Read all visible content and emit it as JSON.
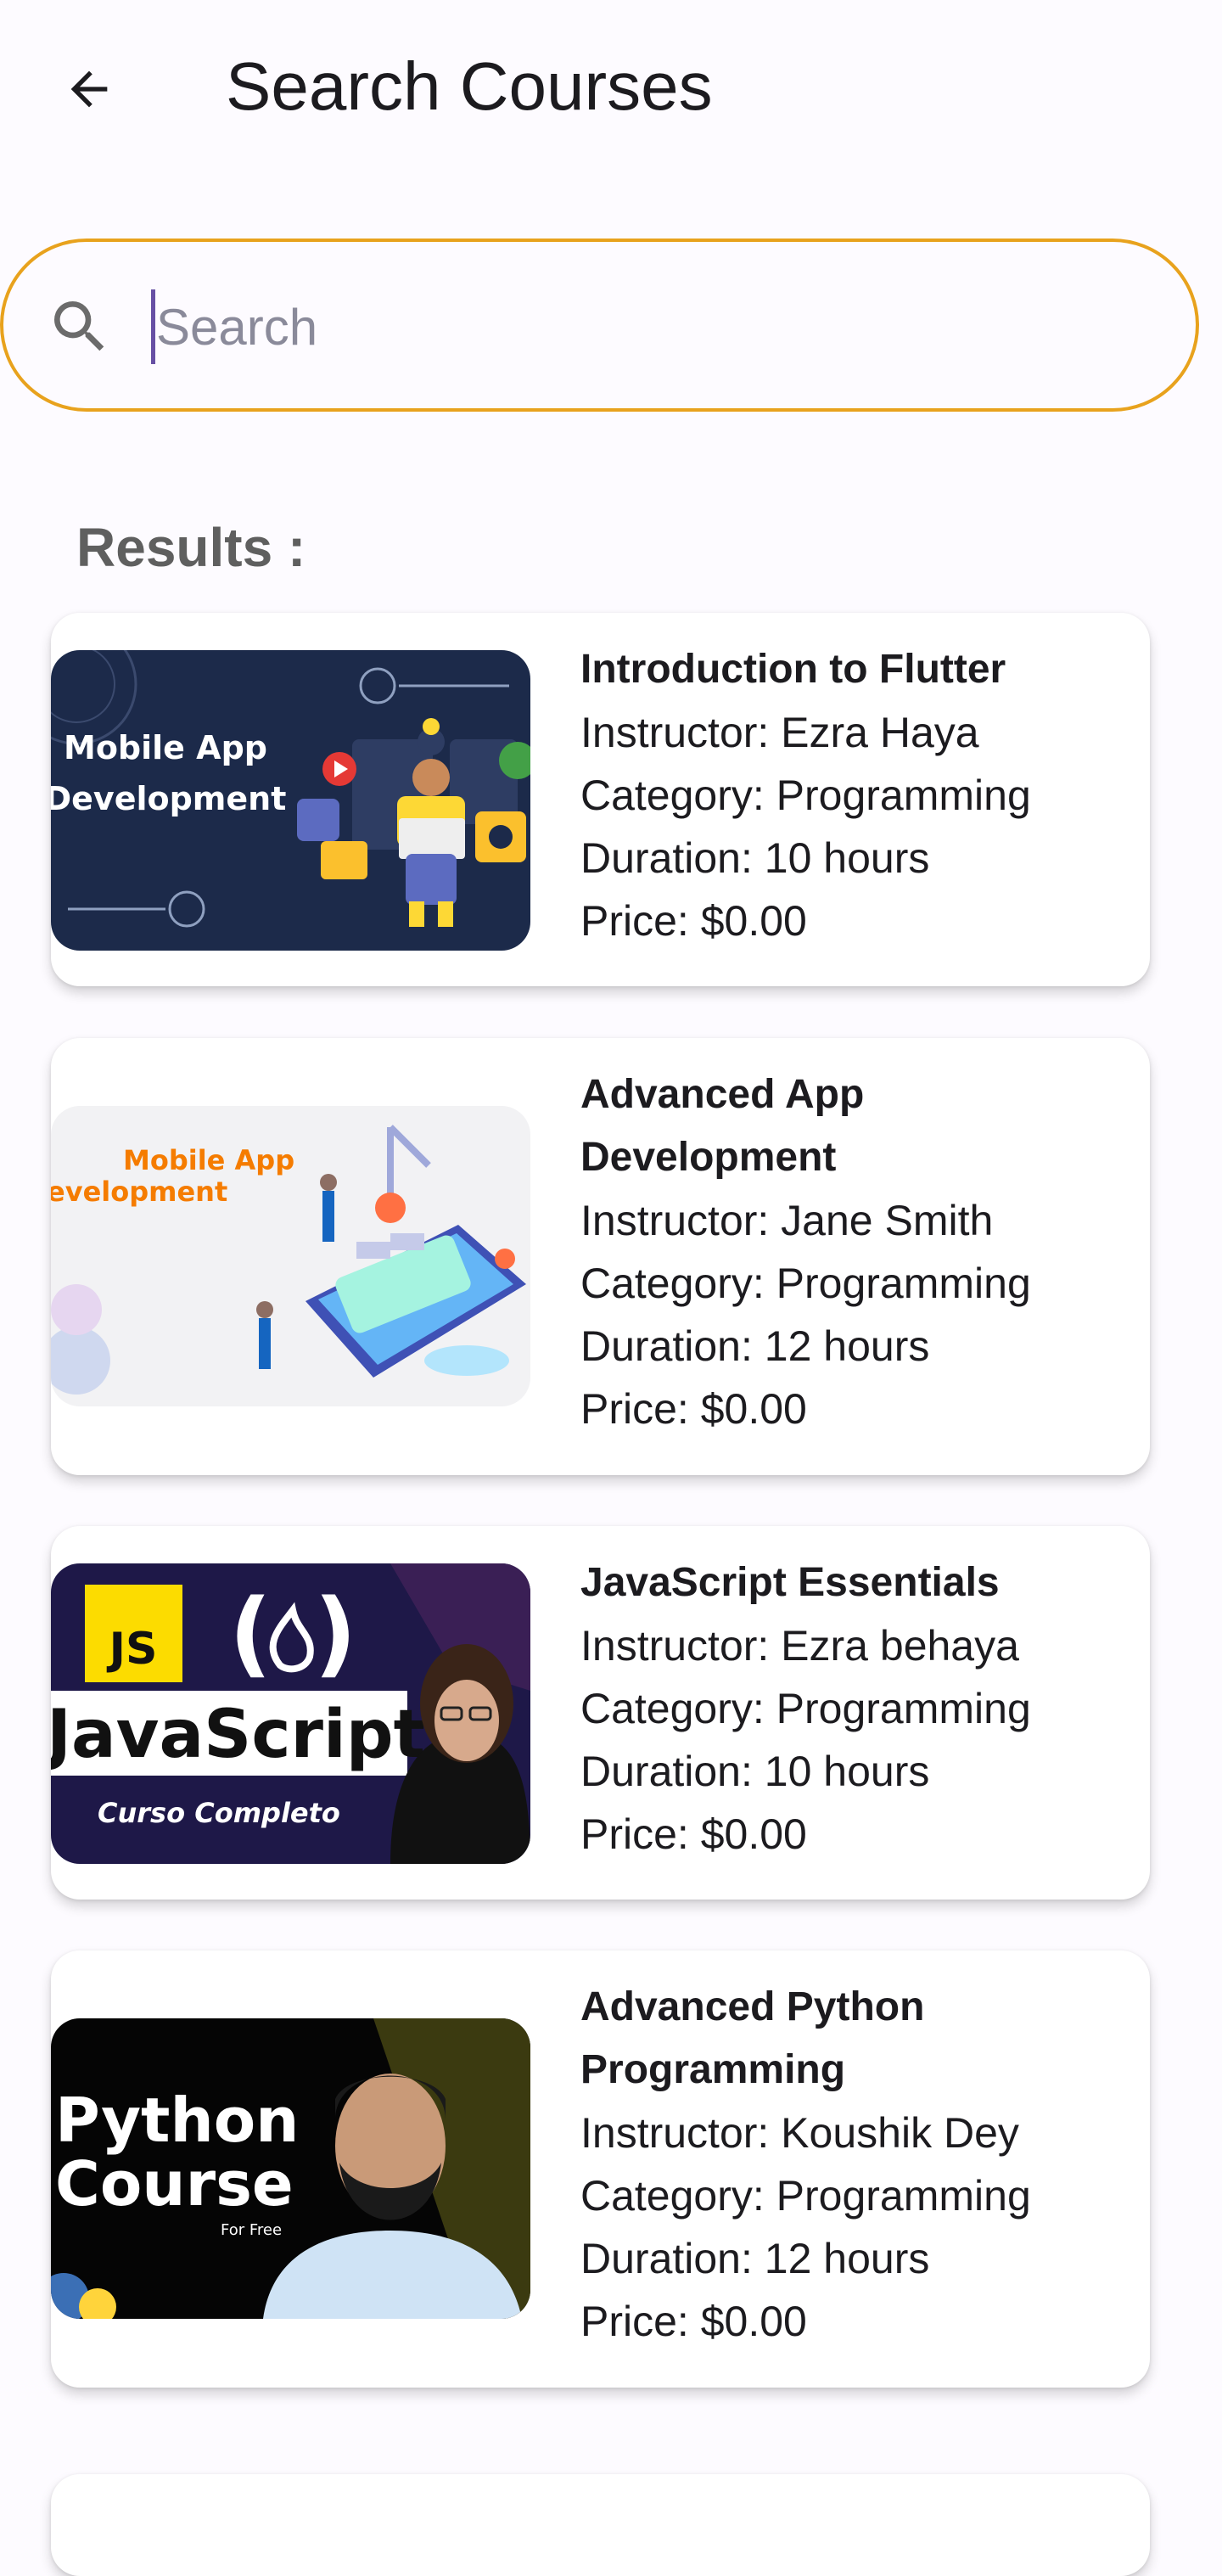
{
  "header": {
    "title": "Search Courses",
    "back_icon": "arrow-back-icon"
  },
  "search": {
    "placeholder": "Search",
    "value": "",
    "icon": "search-icon",
    "border_color": "#e8a21d"
  },
  "results_label": "Results :",
  "courses": [
    {
      "title": "Introduction to Flutter",
      "instructor": "Instructor: Ezra Haya",
      "category": "Category: Programming",
      "duration": "Duration: 10 hours",
      "price": "Price: $0.00",
      "thumb_text": [
        "Mobile App",
        "Development"
      ]
    },
    {
      "title": "Advanced App Development",
      "instructor": "Instructor: Jane Smith",
      "category": "Category: Programming",
      "duration": "Duration: 12 hours",
      "price": "Price: $0.00",
      "thumb_text": [
        "Mobile App",
        "evelopment"
      ]
    },
    {
      "title": "JavaScript Essentials",
      "instructor": "Instructor: Ezra behaya",
      "category": "Category: Programming",
      "duration": "Duration: 10 hours",
      "price": "Price: $0.00",
      "thumb_text": [
        "JS",
        "JavaScript",
        "Curso Completo"
      ]
    },
    {
      "title": "Advanced Python Programming",
      "instructor": "Instructor: Koushik Dey",
      "category": "Category: Programming",
      "duration": "Duration: 12 hours",
      "price": "Price: $0.00",
      "thumb_text": [
        "Python",
        "Course",
        "For Free"
      ]
    }
  ],
  "colors": {
    "accent": "#e8a21d",
    "caret": "#6750a4",
    "background": "#fdfbff"
  }
}
